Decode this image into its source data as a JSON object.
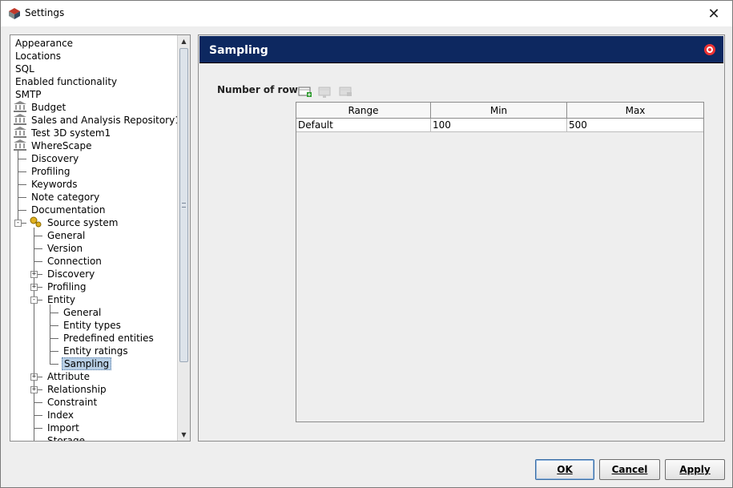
{
  "window": {
    "title": "Settings",
    "icon": "settings-app-icon",
    "close_glyph": "✕"
  },
  "tree": {
    "items": [
      {
        "label": "Appearance"
      },
      {
        "label": "Locations"
      },
      {
        "label": "SQL"
      },
      {
        "label": "Enabled functionality"
      },
      {
        "label": "SMTP"
      },
      {
        "label": "Budget",
        "icon": "bank-icon"
      },
      {
        "label": "Sales and Analysis Repository1",
        "icon": "bank-icon"
      },
      {
        "label": "Test 3D system1",
        "icon": "bank-icon"
      },
      {
        "label": "WhereScape",
        "icon": "bank-icon"
      },
      {
        "label": "Discovery"
      },
      {
        "label": "Profiling"
      },
      {
        "label": "Keywords"
      },
      {
        "label": "Note category"
      },
      {
        "label": "Documentation"
      },
      {
        "label": "Source system",
        "icon": "source-system-icon",
        "expander": "-"
      },
      {
        "label": "General"
      },
      {
        "label": "Version"
      },
      {
        "label": "Connection"
      },
      {
        "label": "Discovery",
        "expander": "+"
      },
      {
        "label": "Profiling",
        "expander": "+"
      },
      {
        "label": "Entity",
        "expander": "-"
      },
      {
        "label": "General"
      },
      {
        "label": "Entity types"
      },
      {
        "label": "Predefined entities"
      },
      {
        "label": "Entity ratings"
      },
      {
        "label": "Sampling",
        "selected": true
      },
      {
        "label": "Attribute",
        "expander": "+"
      },
      {
        "label": "Relationship",
        "expander": "+"
      },
      {
        "label": "Constraint"
      },
      {
        "label": "Index"
      },
      {
        "label": "Import"
      },
      {
        "label": "Storage"
      }
    ]
  },
  "content": {
    "title": "Sampling",
    "rows_label": "Number of rows:",
    "toolbar": [
      "add-row-icon",
      "edit-row-icon",
      "delete-row-icon"
    ],
    "table": {
      "columns": [
        "Range",
        "Min",
        "Max"
      ],
      "rows": [
        [
          "Default",
          "100",
          "500"
        ]
      ]
    }
  },
  "buttons": {
    "ok": "OK",
    "cancel": "Cancel",
    "apply": "Apply"
  }
}
